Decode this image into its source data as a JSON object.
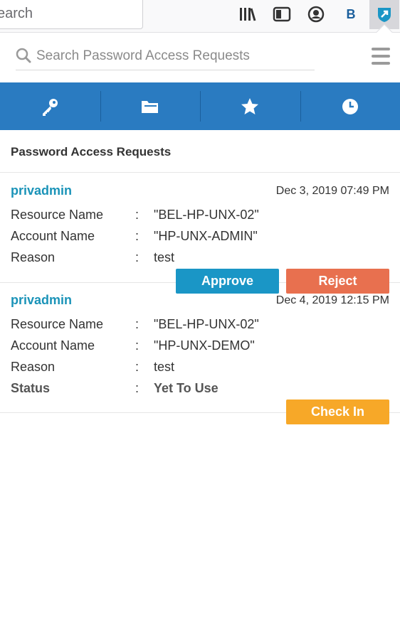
{
  "browser": {
    "url_text": "earch",
    "icons": [
      "library-icon",
      "sidebar-icon",
      "account-icon",
      "bold-b-icon",
      "extension-shield-icon"
    ],
    "extension_badge_color": "#1a96c6"
  },
  "search": {
    "placeholder": "Search Password Access Requests"
  },
  "tabs": [
    {
      "icon": "key-icon"
    },
    {
      "icon": "folder-icon"
    },
    {
      "icon": "star-icon"
    },
    {
      "icon": "clock-icon"
    }
  ],
  "colors": {
    "tab_bar": "#2a7bc1",
    "username": "#1a93b8",
    "approve": "#1a96c6",
    "reject": "#e8704f",
    "check_in": "#f7a828"
  },
  "section": {
    "title": "Password Access Requests"
  },
  "requests": [
    {
      "user": "privadmin",
      "date": "Dec 3, 2019 07:49 PM",
      "fields": [
        {
          "label": "Resource Name",
          "sep": ":",
          "value": "\"BEL-HP-UNX-02\""
        },
        {
          "label": "Account Name",
          "sep": ":",
          "value": "\"HP-UNX-ADMIN\""
        },
        {
          "label": "Reason",
          "sep": ":",
          "value": "test"
        }
      ],
      "approve_label": "Approve",
      "reject_label": "Reject"
    },
    {
      "user": "privadmin",
      "date": "Dec 4, 2019 12:15 PM",
      "fields": [
        {
          "label": "Resource Name",
          "sep": ":",
          "value": "\"BEL-HP-UNX-02\""
        },
        {
          "label": "Account Name",
          "sep": ":",
          "value": "\"HP-UNX-DEMO\""
        },
        {
          "label": "Reason",
          "sep": ":",
          "value": "test"
        },
        {
          "label": "Status",
          "sep": ":",
          "value": "Yet To Use"
        }
      ],
      "checkin_label": "Check In"
    }
  ]
}
